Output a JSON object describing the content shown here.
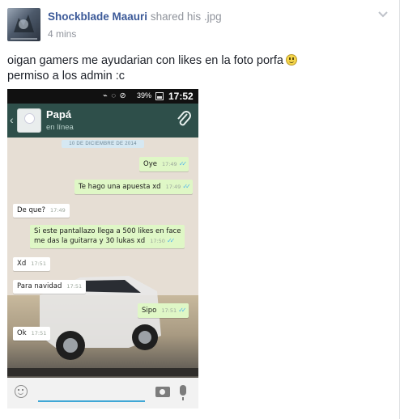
{
  "post": {
    "author_name": "Shockblade Maauri",
    "action_text": "shared his .jpg",
    "timestamp": "4 mins",
    "message_line1": "oigan gamers me ayudarian con likes en la foto porfa",
    "message_line2": "permiso a los admin :c",
    "emoji": "smiley-icon"
  },
  "screenshot": {
    "status_bar": {
      "battery": "39%",
      "clock": "17:52"
    },
    "chat_header": {
      "contact_name": "Papá",
      "contact_status": "en línea"
    },
    "date_chip": "10 DE DICIEMBRE DE 2014",
    "messages": [
      {
        "direction": "out",
        "text": "Oye",
        "time": "17:49",
        "ticks": "✓✓"
      },
      {
        "direction": "out",
        "text": "Te hago una apuesta xd",
        "time": "17:49",
        "ticks": "✓✓"
      },
      {
        "direction": "in",
        "text": "De que?",
        "time": "17:49"
      },
      {
        "direction": "out",
        "text": "Si este pantallazo llega a 500 likes en face",
        "text2": "me das la guitarra y 30 lukas xd",
        "time": "17:50",
        "ticks": "✓✓"
      },
      {
        "direction": "in",
        "text": "Xd",
        "time": "17:51"
      },
      {
        "direction": "in",
        "text": "Para navidad",
        "time": "17:51"
      },
      {
        "direction": "out",
        "text": "Sipo",
        "time": "17:51",
        "ticks": "✓✓"
      },
      {
        "direction": "in",
        "text": "Ok",
        "time": "17:51"
      }
    ]
  },
  "colors": {
    "link_blue": "#3b5998",
    "meta_gray": "#90949c",
    "chat_header": "#2e4f4a",
    "bubble_out": "#dff7c6",
    "bubble_in": "#ffffff",
    "read_ticks": "#4fb6ec"
  }
}
